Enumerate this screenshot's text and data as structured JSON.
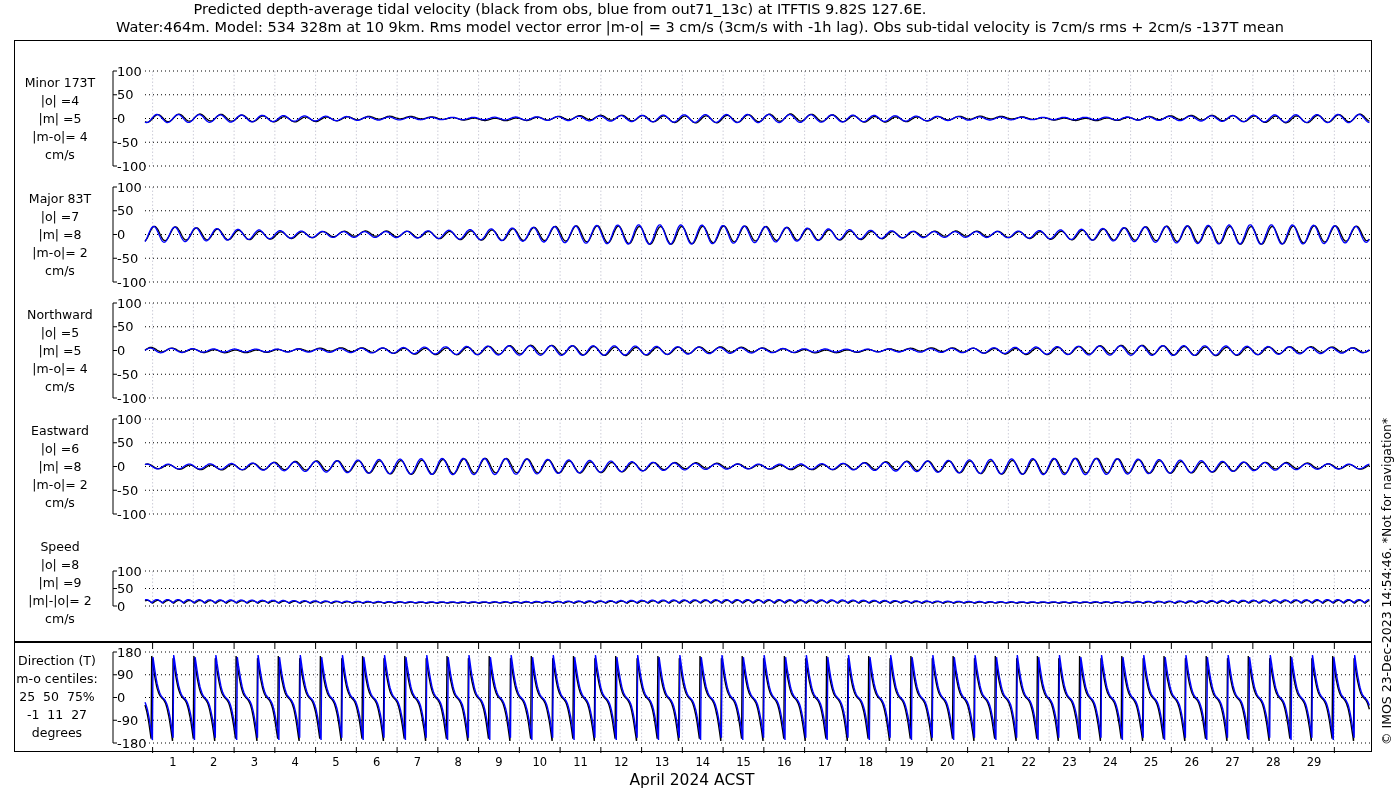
{
  "title_lines": [
    "Predicted depth-average tidal velocity (black from obs, blue from out71_13c) at ITFTIS 9.82S 127.6E.",
    "Water:464m. Model: 534 328m at 10 9km. Rms model vector error |m-o| = 3 cm/s (3cm/s with -1h lag). Obs sub-tidal velocity is 7cm/s rms + 2cm/s -137T mean"
  ],
  "panels": [
    {
      "kind": "velocity",
      "title": "Minor 173T",
      "stats": [
        "|o| =4",
        "|m| =5",
        "|m-o|= 4"
      ],
      "units": "cm/s",
      "yticks": [
        "100",
        "50",
        "0",
        "-50",
        "-100"
      ]
    },
    {
      "kind": "velocity",
      "title": "Major 83T",
      "stats": [
        "|o| =7",
        "|m| =8",
        "|m-o|= 2"
      ],
      "units": "cm/s",
      "yticks": [
        "100",
        "50",
        "0",
        "-50",
        "-100"
      ]
    },
    {
      "kind": "velocity",
      "title": "Northward",
      "stats": [
        "|o| =5",
        "|m| =5",
        "|m-o|= 4"
      ],
      "units": "cm/s",
      "yticks": [
        "100",
        "50",
        "0",
        "-50",
        "-100"
      ]
    },
    {
      "kind": "velocity",
      "title": "Eastward",
      "stats": [
        "|o| =6",
        "|m| =8",
        "|m-o|= 2"
      ],
      "units": "cm/s",
      "yticks": [
        "100",
        "50",
        "0",
        "-50",
        "-100"
      ]
    },
    {
      "kind": "speed",
      "title": "Speed",
      "stats": [
        "|o| =8",
        "|m| =9",
        "|m|-|o|= 2"
      ],
      "units": "cm/s",
      "yticks": [
        "100",
        "50",
        "0"
      ]
    }
  ],
  "direction": {
    "kind": "direction",
    "lines": [
      "Direction (T)",
      "m-o centiles:",
      "25  50  75%",
      "-1  11  27",
      "degrees"
    ],
    "yticks": [
      "180",
      "90",
      "0",
      "-90",
      "-180"
    ]
  },
  "days": [
    "1",
    "2",
    "3",
    "4",
    "5",
    "6",
    "7",
    "8",
    "9",
    "10",
    "11",
    "12",
    "13",
    "14",
    "15",
    "16",
    "17",
    "18",
    "19",
    "20",
    "21",
    "22",
    "23",
    "24",
    "25",
    "26",
    "27",
    "28",
    "29"
  ],
  "xlabel": "April 2024 ACST",
  "credit": "© IMOS 23-Dec-2023 14:54:46. *Not for navigation*"
}
